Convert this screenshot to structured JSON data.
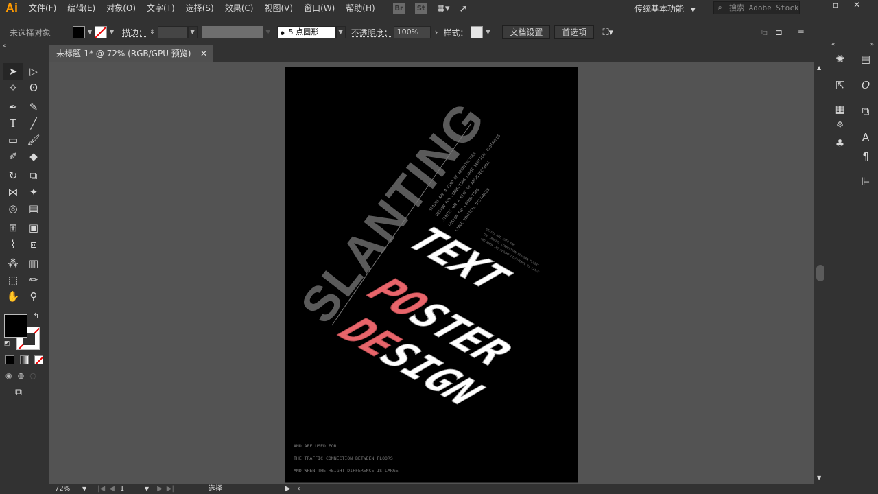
{
  "app": {
    "logo": "Ai"
  },
  "menu": [
    "文件(F)",
    "编辑(E)",
    "对象(O)",
    "文字(T)",
    "选择(S)",
    "效果(C)",
    "视图(V)",
    "窗口(W)",
    "帮助(H)"
  ],
  "menu_icons": [
    "Br",
    "St"
  ],
  "workspace": "传统基本功能",
  "search_placeholder": "搜索 Adobe Stock",
  "control": {
    "selection_label": "未选择对象",
    "stroke_label": "描边：",
    "brush_dot": "●",
    "brush_label": "5 点圆形",
    "opacity_label": "不透明度：",
    "opacity_value": "100%",
    "style_label": "样式：",
    "doc_setup": "文档设置",
    "preferences": "首选项"
  },
  "document": {
    "tab_title": "未标题-1* @ 72% (RGB/GPU 预览)"
  },
  "poster": {
    "slanting": "SLANTING",
    "line1": "TEXT",
    "line2_accent": "PO",
    "line2_rest": "STER",
    "line3_accent": "DE",
    "line3_rest": "SIGN",
    "small_block1": [
      "STAIRS ARE A KIND OF ARCHITECTURE",
      "DESIGN FOR CONNECTING LARGE VERTICAL DISTANCES",
      "STAIRS ARE A KIND OF ARCHITECTURAL",
      "DESIGN FOR CONNECTING",
      "LARGE VERTICAL DISTANCES"
    ],
    "small_block2": [
      "STAIRS ARE USED FOR",
      "THE TRAFFIC CONNECTION BETWEEN FLOORS",
      "AND WHEN THE HEIGHT DIFFERENCE IS LARGE"
    ],
    "bottom_lines": [
      "AND ARE USED FOR",
      "THE TRAFFIC CONNECTION BETWEEN FLOORS",
      "AND WHEN THE HEIGHT DIFFERENCE IS LARGE"
    ],
    "colors": {
      "accent": "#e8656b",
      "white": "#ffffff",
      "gray": "#5a5a5a"
    }
  },
  "status": {
    "zoom": "72%",
    "page": "1",
    "mode": "选择"
  }
}
